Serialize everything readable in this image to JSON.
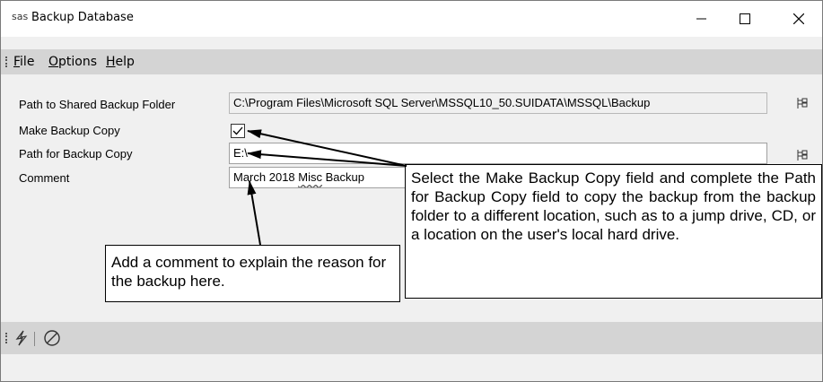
{
  "window": {
    "app_icon_text": "sas",
    "title": "Backup Database",
    "min_icon": "minimize-icon",
    "max_icon": "maximize-icon",
    "close_icon": "close-icon"
  },
  "menu": {
    "file_u": "F",
    "file_rest": "ile",
    "options_u": "O",
    "options_rest": "ptions",
    "help_u": "H",
    "help_rest": "elp"
  },
  "form": {
    "shared_label": "Path to Shared Backup Folder",
    "shared_value": "C:\\Program Files\\Microsoft SQL Server\\MSSQL10_50.SUIDATA\\MSSQL\\Backup",
    "make_copy_label": "Make Backup Copy",
    "make_copy_checked": true,
    "copy_path_label": "Path for Backup Copy",
    "copy_path_value": "E:\\",
    "comment_label": "Comment",
    "comment_pre": "March 2018 ",
    "comment_misc": "Misc",
    "comment_post": " Backup"
  },
  "callouts": {
    "backup_copy": "Select the Make Backup Copy field and complete the Path for Backup Copy field to copy the backup from the backup folder to a different location, such as to a jump drive, CD, or a location on the user's local hard drive.",
    "comment": "Add a comment to explain the reason for the backup here."
  },
  "toolbar": {
    "run_icon": "lightning-icon",
    "cancel_icon": "cancel-icon"
  }
}
